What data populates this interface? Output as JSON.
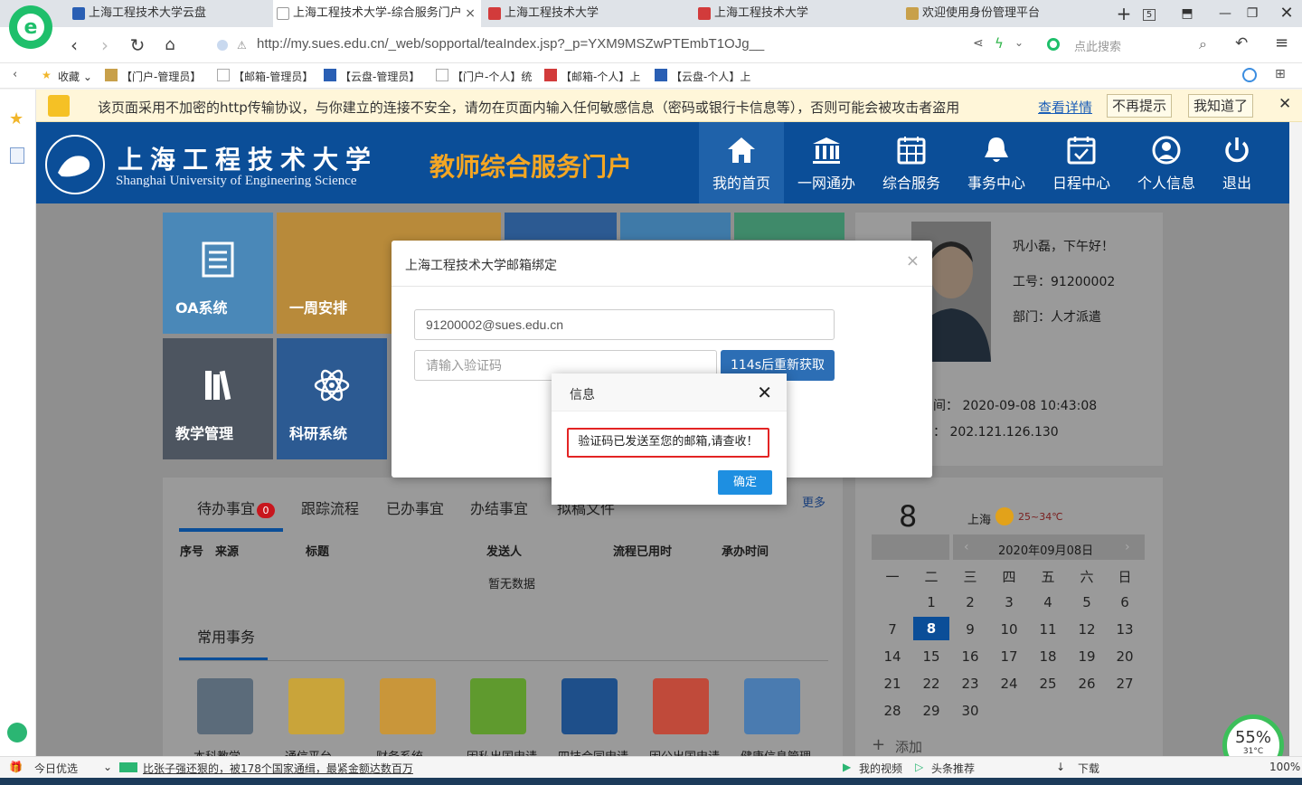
{
  "browser": {
    "tabs": [
      {
        "label": "上海工程技术大学云盘",
        "fav": "#2a5fb4"
      },
      {
        "label": "上海工程技术大学-综合服务门户",
        "fav": "#999999"
      },
      {
        "label": "上海工程技术大学",
        "fav": "#d23b3b"
      },
      {
        "label": "上海工程技术大学",
        "fav": "#d23b3b"
      },
      {
        "label": "欢迎使用身份管理平台",
        "fav": "#c8a04a"
      }
    ],
    "tab_count": "5",
    "url": "http://my.sues.edu.cn/_web/sopportal/teaIndex.jsp?_p=YXM9MSZwPTEmbT1OJg__",
    "search_placeholder": "点此搜索",
    "bookmarks": [
      {
        "label": "收藏"
      },
      {
        "label": "【门户-管理员】"
      },
      {
        "label": "【邮箱-管理员】"
      },
      {
        "label": "【云盘-管理员】"
      },
      {
        "label": "【门户-个人】统"
      },
      {
        "label": "【邮箱-个人】上"
      },
      {
        "label": "【云盘-个人】上"
      }
    ],
    "warning": {
      "text": "该页面采用不加密的http传输协议，与你建立的连接不安全，请勿在页面内输入任何敏感信息（密码或银行卡信息等），否则可能会被攻击者盗用",
      "link": "查看详情",
      "btn_nomore": "不再提示",
      "btn_ok": "我知道了"
    }
  },
  "portal": {
    "logo_cn": "上海工程技术大学",
    "logo_en": "Shanghai University of  Engineering Science",
    "title": "教师综合服务门户",
    "nav": [
      {
        "label": "我的首页",
        "icon": "home-icon"
      },
      {
        "label": "一网通办",
        "icon": "bank-icon"
      },
      {
        "label": "综合服务",
        "icon": "grid-calendar-icon"
      },
      {
        "label": "事务中心",
        "icon": "bell-icon"
      },
      {
        "label": "日程中心",
        "icon": "calendar-check-icon"
      },
      {
        "label": "个人信息",
        "icon": "user-icon"
      },
      {
        "label": "退出",
        "icon": "power-icon"
      }
    ],
    "tiles": [
      {
        "label": "OA系统",
        "color": "#4a88b8"
      },
      {
        "label": "一周安排",
        "color": "#b88a3a"
      },
      {
        "label": "教学管理",
        "color": "#4d5560"
      },
      {
        "label": "科研系统",
        "color": "#2c5a92"
      }
    ],
    "profile": {
      "greeting": "巩小磊，下午好！",
      "staff_id": "工号：91200002",
      "dept": "部门：人才派遣",
      "last_login": "间： 2020-09-08 10:43:08",
      "ip": "： 202.121.126.130"
    },
    "task_tabs": [
      "待办事宜",
      "跟踪流程",
      "已办事宜",
      "办结事宜",
      "拟稿文件"
    ],
    "task_badge": "0",
    "more": "更多",
    "table_headers": [
      "序号",
      "来源",
      "标题",
      "发送人",
      "流程已用时",
      "承办时间"
    ],
    "no_data": "暂无数据",
    "common_title": "常用事务",
    "common_items": [
      {
        "label": "本科教学",
        "color": "#5b6b7a"
      },
      {
        "label": "通信平台",
        "color": "#c9a43a"
      },
      {
        "label": "财务系统",
        "color": "#c9963a"
      },
      {
        "label": "因私出国申请",
        "color": "#5f9a2e"
      },
      {
        "label": "四技合同申请",
        "color": "#1e4f8a"
      },
      {
        "label": "因公出国申请",
        "color": "#c04a3a"
      },
      {
        "label": "健康信息管理",
        "color": "#4a7bb0"
      }
    ],
    "calendar": {
      "day": "8",
      "city": "上海",
      "temp": "25~34℃",
      "month_label": "2020年09月08日",
      "weekdays": [
        "一",
        "二",
        "三",
        "四",
        "五",
        "六",
        "日"
      ],
      "days": [
        "",
        "1",
        "2",
        "3",
        "4",
        "5",
        "6",
        "7",
        "8",
        "9",
        "10",
        "11",
        "12",
        "13",
        "14",
        "15",
        "16",
        "17",
        "18",
        "19",
        "20",
        "21",
        "22",
        "23",
        "24",
        "25",
        "26",
        "27",
        "28",
        "29",
        "30"
      ],
      "add": "添加"
    }
  },
  "bind_dialog": {
    "title": "上海工程技术大学邮箱绑定",
    "email": "91200002@sues.edu.cn",
    "code_placeholder": "请输入验证码",
    "get_btn": "114s后重新获取"
  },
  "info_dialog": {
    "title": "信息",
    "message": "验证码已发送至您的邮箱,请查收！",
    "ok": "确定"
  },
  "statusbar": {
    "today": "今日优选",
    "news": "比张子强还狠的，被178个国家通缉，最紧金额达数百万",
    "video": "我的视频",
    "headline": "头条推荐",
    "download": "下载",
    "zoom": "100%",
    "speed": "55%",
    "cpu_temp": "31°C"
  }
}
